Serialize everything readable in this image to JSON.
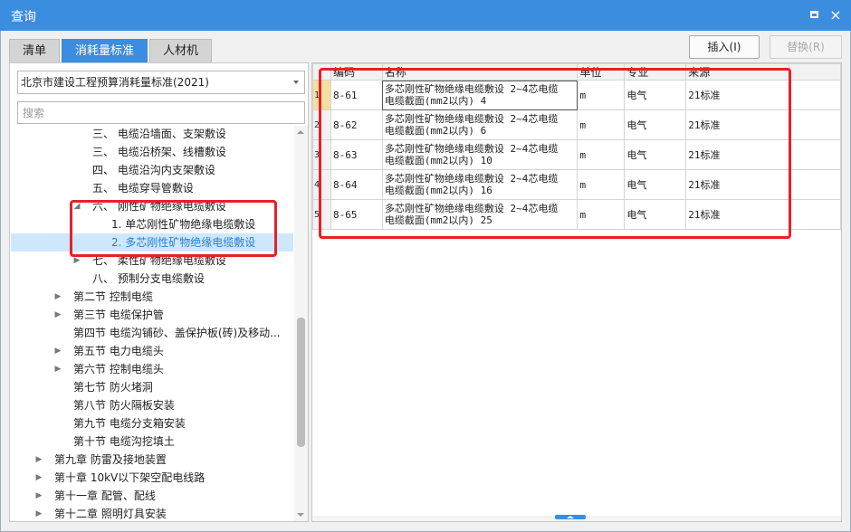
{
  "window": {
    "title": "查询",
    "maximize_icon": "maximize-icon",
    "close_icon": "close-icon",
    "close_glyph": "×"
  },
  "tabs": [
    {
      "label": "清单",
      "active": false
    },
    {
      "label": "消耗量标准",
      "active": true
    },
    {
      "label": "人材机",
      "active": false
    }
  ],
  "toolbar": {
    "insert_label": "插入(I)",
    "replace_label": "替换(R)"
  },
  "left": {
    "standard_select": "北京市建设工程预算消耗量标准(2021)",
    "search_placeholder": "搜索",
    "tree": [
      {
        "label": "三、  电缆沿墙面、支架敷设",
        "level": 3,
        "arrow": ""
      },
      {
        "label": "三、  电缆沿桥架、线槽敷设",
        "level": 3,
        "arrow": ""
      },
      {
        "label": "四、  电缆沿沟内支架敷设",
        "level": 3,
        "arrow": ""
      },
      {
        "label": "五、  电缆穿导管敷设",
        "level": 3,
        "arrow": ""
      },
      {
        "label": "六、  刚性矿物绝缘电缆敷设",
        "level": 3,
        "arrow": "expanded"
      },
      {
        "label": "1. 单芯刚性矿物绝缘电缆敷设",
        "level": 4,
        "arrow": ""
      },
      {
        "label": "2. 多芯刚性矿物绝缘电缆敷设",
        "level": 4,
        "arrow": "",
        "selected": true
      },
      {
        "label": "七、  柔性矿物绝缘电缆敷设",
        "level": 3,
        "arrow": "collapsed"
      },
      {
        "label": "八、  预制分支电缆敷设",
        "level": 3,
        "arrow": ""
      },
      {
        "label": "第二节 控制电缆",
        "level": 2,
        "arrow": "collapsed"
      },
      {
        "label": "第三节 电缆保护管",
        "level": 2,
        "arrow": "collapsed"
      },
      {
        "label": "第四节 电缆沟铺砂、盖保护板(砖)及移动...",
        "level": 2,
        "arrow": ""
      },
      {
        "label": "第五节 电力电缆头",
        "level": 2,
        "arrow": "collapsed"
      },
      {
        "label": "第六节 控制电缆头",
        "level": 2,
        "arrow": "collapsed"
      },
      {
        "label": "第七节 防火堵洞",
        "level": 2,
        "arrow": ""
      },
      {
        "label": "第八节 防火隔板安装",
        "level": 2,
        "arrow": ""
      },
      {
        "label": "第九节 电缆分支箱安装",
        "level": 2,
        "arrow": ""
      },
      {
        "label": "第十节 电缆沟挖填土",
        "level": 2,
        "arrow": ""
      },
      {
        "label": "第九章 防雷及接地装置",
        "level": 1,
        "arrow": "collapsed"
      },
      {
        "label": "第十章 10kV以下架空配电线路",
        "level": 1,
        "arrow": "collapsed"
      },
      {
        "label": "第十一章 配管、配线",
        "level": 1,
        "arrow": "collapsed"
      },
      {
        "label": "第十二章 照明灯具安装",
        "level": 1,
        "arrow": "collapsed"
      }
    ]
  },
  "grid": {
    "columns": [
      "编码",
      "名称",
      "单位",
      "专业",
      "来源"
    ],
    "rows": [
      {
        "num": "1",
        "code": "8-61",
        "name": "多芯刚性矿物绝缘电缆敷设 2~4芯电缆\n电缆截面(mm2以内) 4",
        "unit": "m",
        "major": "电气",
        "source": "21标准"
      },
      {
        "num": "2",
        "code": "8-62",
        "name": "多芯刚性矿物绝缘电缆敷设 2~4芯电缆\n电缆截面(mm2以内) 6",
        "unit": "m",
        "major": "电气",
        "source": "21标准"
      },
      {
        "num": "3",
        "code": "8-63",
        "name": "多芯刚性矿物绝缘电缆敷设 2~4芯电缆\n电缆截面(mm2以内) 10",
        "unit": "m",
        "major": "电气",
        "source": "21标准"
      },
      {
        "num": "4",
        "code": "8-64",
        "name": "多芯刚性矿物绝缘电缆敷设 2~4芯电缆\n电缆截面(mm2以内) 16",
        "unit": "m",
        "major": "电气",
        "source": "21标准"
      },
      {
        "num": "5",
        "code": "8-65",
        "name": "多芯刚性矿物绝缘电缆敷设 2~4芯电缆\n电缆截面(mm2以内) 25",
        "unit": "m",
        "major": "电气",
        "source": "21标准"
      }
    ]
  },
  "colors": {
    "accent": "#3b8de0",
    "highlight_box": "#e8202a",
    "selected_row": "#cde8fb"
  }
}
